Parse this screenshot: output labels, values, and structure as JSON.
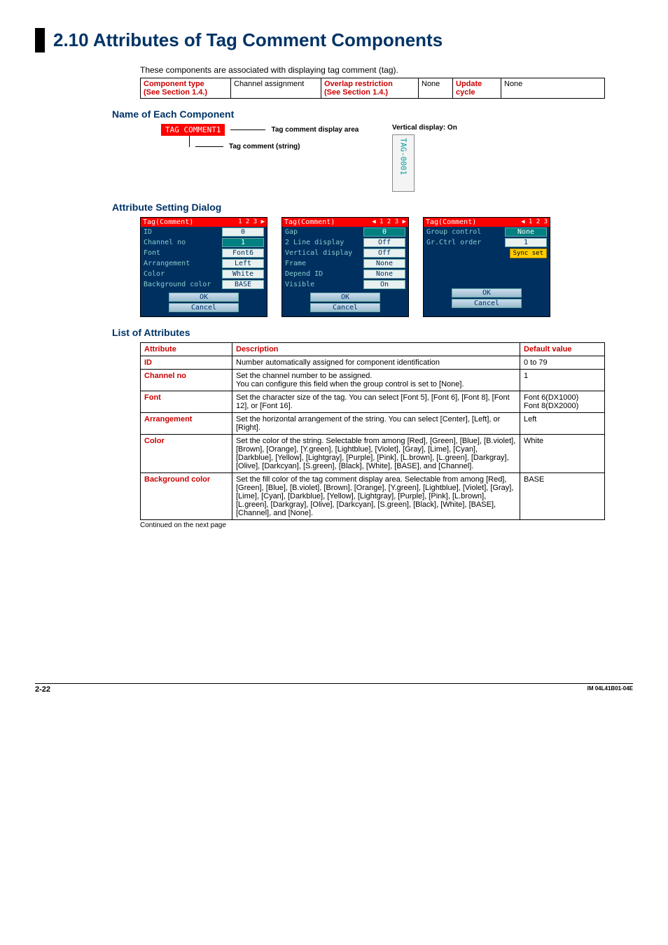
{
  "heading": {
    "num": "2.10",
    "title": "Attributes of Tag Comment Components"
  },
  "intro": "These components are associated with displaying tag comment (tag).",
  "component_table": {
    "labels": {
      "component_type": "Component type",
      "see_section": "(See Section 1.4.)",
      "channel_assignment": "Channel assignment",
      "overlap_restriction": "Overlap restriction",
      "none": "None",
      "update_cycle": "Update cycle"
    },
    "values": {
      "overlap_value": "None",
      "update_value": "None"
    }
  },
  "subheads": {
    "name_each": "Name of Each Component",
    "attr_dialog": "Attribute Setting Dialog",
    "list_attrs": "List of Attributes"
  },
  "figure": {
    "chip": "TAG COMMENT1",
    "annot1": "Tag comment display area",
    "annot2": "Tag comment (string)",
    "vertical_label": "Vertical display: On",
    "vertical_text": "TAG-0001"
  },
  "dialogs": [
    {
      "title": "Tag(Comment)",
      "pager": "1 2 3 ▶",
      "rows": [
        {
          "label": "ID",
          "value": "0",
          "hl": false
        },
        {
          "label": "Channel no",
          "value": "1",
          "hl": true
        },
        {
          "label": "Font",
          "value": "Font6",
          "hl": false
        },
        {
          "label": "Arrangement",
          "value": "Left",
          "hl": false
        },
        {
          "label": "Color",
          "value": "White",
          "hl": false
        },
        {
          "label": "Background color",
          "value": "BASE",
          "hl": false
        }
      ],
      "ok": "OK",
      "cancel": "Cancel"
    },
    {
      "title": "Tag(Comment)",
      "pager": "◀ 1 2 3 ▶",
      "rows": [
        {
          "label": "Gap",
          "value": "0",
          "hl": true
        },
        {
          "label": "2 Line display",
          "value": "Off",
          "hl": false
        },
        {
          "label": "Vertical display",
          "value": "Off",
          "hl": false
        },
        {
          "label": "Frame",
          "value": "None",
          "hl": false
        },
        {
          "label": "Depend ID",
          "value": "None",
          "hl": false
        },
        {
          "label": "Visible",
          "value": "On",
          "hl": false
        }
      ],
      "ok": "OK",
      "cancel": "Cancel"
    },
    {
      "title": "Tag(Comment)",
      "pager": "◀ 1 2 3",
      "rows": [
        {
          "label": "Group control",
          "value": "None",
          "hl": true
        },
        {
          "label": "Gr.Ctrl order",
          "value": "1",
          "hl": false
        }
      ],
      "sync": "Sync set",
      "ok": "OK",
      "cancel": "Cancel"
    }
  ],
  "attrs_header": {
    "attr": "Attribute",
    "desc": "Description",
    "def": "Default value"
  },
  "attrs": [
    {
      "name": "ID",
      "desc": "Number automatically assigned for component identification",
      "def": "0 to 79"
    },
    {
      "name": "Channel no",
      "desc": "Set the channel number to be assigned.\nYou can configure this field when the group control is set to [None].",
      "def": "1"
    },
    {
      "name": "Font",
      "desc": "Set the character size of the tag. You can select [Font 5], [Font 6], [Font 8], [Font 12], or [Font 16].",
      "def": "Font 6(DX1000)\nFont 8(DX2000)"
    },
    {
      "name": "Arrangement",
      "desc": "Set the horizontal arrangement of the string. You can select [Center], [Left], or [Right].",
      "def": "Left"
    },
    {
      "name": "Color",
      "desc": "Set the color of the string. Selectable from among [Red], [Green], [Blue], [B.violet], [Brown], [Orange], [Y.green], [Lightblue], [Violet], [Gray], [Lime], [Cyan], [Darkblue], [Yellow], [Lightgray], [Purple], [Pink], [L.brown], [L.green], [Darkgray], [Olive], [Darkcyan], [S.green], [Black], [White], [BASE], and [Channel].",
      "def": "White"
    },
    {
      "name": "Background color",
      "desc": "Set the fill color of the tag comment display area. Selectable from among [Red], [Green], [Blue], [B.violet], [Brown], [Orange], [Y.green], [Lightblue], [Violet], [Gray], [Lime], [Cyan], [Darkblue], [Yellow], [Lightgray], [Purple], [Pink], [L.brown], [L.green], [Darkgray], [Olive], [Darkcyan], [S.green], [Black], [White], [BASE], [Channel], and [None].",
      "def": "BASE"
    }
  ],
  "continued": "Continued on the next page",
  "footer": {
    "page": "2-22",
    "doc": "IM 04L41B01-04E"
  }
}
